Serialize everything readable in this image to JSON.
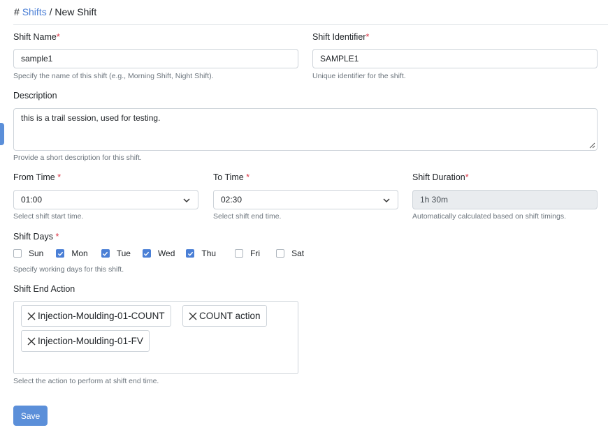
{
  "breadcrumb": {
    "hash": "#",
    "link": "Shifts",
    "separator": "/",
    "current": "New Shift"
  },
  "shift_name": {
    "label": "Shift Name",
    "required": "*",
    "value": "sample1",
    "help": "Specify the name of this shift (e.g., Morning Shift, Night Shift)."
  },
  "shift_identifier": {
    "label": "Shift Identifier",
    "required": "*",
    "value": "SAMPLE1",
    "help": "Unique identifier for the shift."
  },
  "description": {
    "label": "Description",
    "value": "this is a trail session, used for testing.",
    "help": "Provide a short description for this shift."
  },
  "from_time": {
    "label": "From Time",
    "required": "*",
    "value": "01:00",
    "help": "Select shift start time."
  },
  "to_time": {
    "label": "To Time",
    "required": "*",
    "value": "02:30",
    "help": "Select shift end time."
  },
  "shift_duration": {
    "label": "Shift Duration",
    "required": "*",
    "value": "1h 30m",
    "help": "Automatically calculated based on shift timings."
  },
  "shift_days": {
    "label": "Shift Days",
    "required": "*",
    "help": "Specify working days for this shift.",
    "days": [
      {
        "label": "Sun",
        "checked": false
      },
      {
        "label": "Mon",
        "checked": true
      },
      {
        "label": "Tue",
        "checked": true
      },
      {
        "label": "Wed",
        "checked": true
      },
      {
        "label": "Thu",
        "checked": true
      },
      {
        "label": "Fri",
        "checked": false
      },
      {
        "label": "Sat",
        "checked": false
      }
    ]
  },
  "shift_end_action": {
    "label": "Shift End Action",
    "help": "Select the action to perform at shift end time.",
    "selected": [
      "Injection-Moulding-01-COUNT",
      "COUNT action",
      "Injection-Moulding-01-FV"
    ]
  },
  "save_label": "Save",
  "colors": {
    "accent": "#5b8fd9",
    "link": "#4a7fd6",
    "required": "#dc3545"
  }
}
